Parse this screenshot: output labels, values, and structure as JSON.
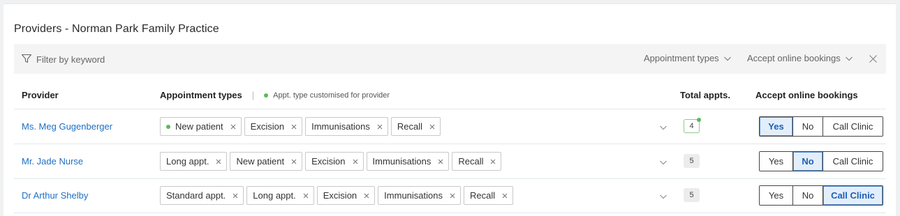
{
  "page": {
    "title": "Providers - Norman Park Family Practice"
  },
  "filter": {
    "placeholder": "Filter by keyword",
    "appointment_types_label": "Appointment types",
    "accept_online_label": "Accept online bookings"
  },
  "table": {
    "headers": {
      "provider": "Provider",
      "appointment_types": "Appointment types",
      "separator": "|",
      "legend": "Appt. type customised for provider",
      "total": "Total appts.",
      "accept": "Accept online bookings"
    },
    "options": {
      "yes": "Yes",
      "no": "No",
      "call": "Call Clinic"
    },
    "rows": [
      {
        "name": "Ms. Meg Gugenberger",
        "chips": [
          {
            "label": "New patient",
            "customised": true
          },
          {
            "label": "Excision",
            "customised": false
          },
          {
            "label": "Immunisations",
            "customised": false
          },
          {
            "label": "Recall",
            "customised": false
          }
        ],
        "total": "4",
        "total_customised": true,
        "accept": "Yes"
      },
      {
        "name": "Mr. Jade Nurse",
        "chips": [
          {
            "label": "Long appt.",
            "customised": false
          },
          {
            "label": "New patient",
            "customised": false
          },
          {
            "label": "Excision",
            "customised": false
          },
          {
            "label": "Immunisations",
            "customised": false
          },
          {
            "label": "Recall",
            "customised": false
          }
        ],
        "total": "5",
        "total_customised": false,
        "accept": "No"
      },
      {
        "name": "Dr Arthur Shelby",
        "chips": [
          {
            "label": "Standard appt.",
            "customised": false
          },
          {
            "label": "Long appt.",
            "customised": false
          },
          {
            "label": "Excision",
            "customised": false
          },
          {
            "label": "Immunisations",
            "customised": false
          },
          {
            "label": "Recall",
            "customised": false
          }
        ],
        "total": "5",
        "total_customised": false,
        "accept": "Call Clinic"
      }
    ]
  },
  "colors": {
    "link": "#1d6fc4",
    "accent_green": "#5cb85c",
    "active_bg": "#e3eefb"
  }
}
